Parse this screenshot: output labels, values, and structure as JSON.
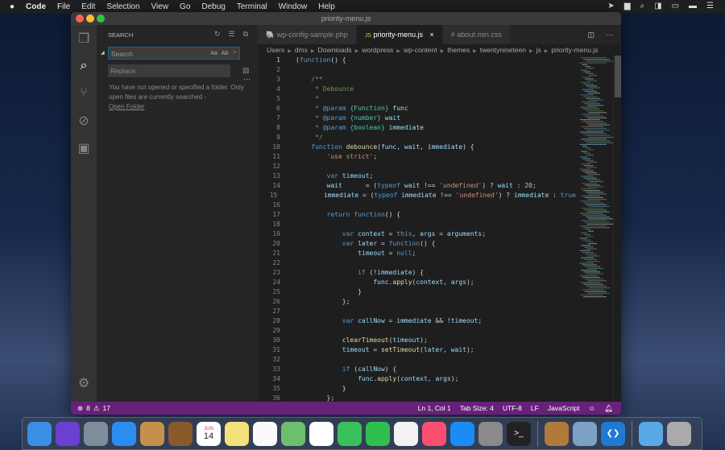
{
  "menubar": {
    "apple": "",
    "app": "Code",
    "items": [
      "File",
      "Edit",
      "Selection",
      "View",
      "Go",
      "Debug",
      "Terminal",
      "Window",
      "Help"
    ]
  },
  "window": {
    "title": "priority-menu.js"
  },
  "activity": [
    "explorer-icon",
    "search-icon",
    "source-control-icon",
    "debug-icon",
    "extensions-icon",
    "gear-icon"
  ],
  "sidebar": {
    "title": "SEARCH",
    "search_placeholder": "Search",
    "replace_placeholder": "Replace",
    "case_opt": "Aa",
    "word_opt": "Ab",
    "regex_opt": ".*",
    "message": "You have not opened or specified a folder. Only open files are currently searched -",
    "open_folder": "Open Folder"
  },
  "tabs": [
    {
      "icon": "php",
      "label": "wp-config-sample.php"
    },
    {
      "icon": "JS",
      "label": "priority-menu.js",
      "close": "×"
    },
    {
      "icon": "#",
      "label": "about.min.css"
    }
  ],
  "breadcrumbs": [
    "Users",
    "dmx",
    "Downloads",
    "wordpress",
    "wp-content",
    "themes",
    "twentynineteen",
    "js",
    "priority-menu.js"
  ],
  "code": [
    [
      [
        "(",
        "p"
      ],
      [
        "function",
        "k"
      ],
      [
        "() {",
        "p"
      ]
    ],
    [],
    [
      [
        "    /**",
        "c"
      ]
    ],
    [
      [
        "     * Debounce",
        "c"
      ]
    ],
    [
      [
        "     *",
        "c"
      ]
    ],
    [
      [
        "     * ",
        "c"
      ],
      [
        "@param",
        "k"
      ],
      [
        " {Function}",
        "t"
      ],
      [
        " func",
        "v"
      ]
    ],
    [
      [
        "     * ",
        "c"
      ],
      [
        "@param",
        "k"
      ],
      [
        " {number}",
        "t"
      ],
      [
        " wait",
        "v"
      ]
    ],
    [
      [
        "     * ",
        "c"
      ],
      [
        "@param",
        "k"
      ],
      [
        " {boolean}",
        "t"
      ],
      [
        " immediate",
        "v"
      ]
    ],
    [
      [
        "     */",
        "c"
      ]
    ],
    [
      [
        "    ",
        "p"
      ],
      [
        "function",
        "k"
      ],
      [
        " ",
        "p"
      ],
      [
        "debounce",
        "f"
      ],
      [
        "(",
        "p"
      ],
      [
        "func",
        "v"
      ],
      [
        ", ",
        "p"
      ],
      [
        "wait",
        "v"
      ],
      [
        ", ",
        "p"
      ],
      [
        "immediate",
        "v"
      ],
      [
        ") {",
        "p"
      ]
    ],
    [
      [
        "        ",
        "p"
      ],
      [
        "'use strict'",
        "s"
      ],
      [
        ";",
        "p"
      ]
    ],
    [],
    [
      [
        "        ",
        "p"
      ],
      [
        "var",
        "k"
      ],
      [
        " ",
        "p"
      ],
      [
        "timeout",
        "v"
      ],
      [
        ";",
        "p"
      ]
    ],
    [
      [
        "        ",
        "p"
      ],
      [
        "wait",
        "v"
      ],
      [
        "      = (",
        "p"
      ],
      [
        "typeof",
        "k"
      ],
      [
        " ",
        "p"
      ],
      [
        "wait",
        "v"
      ],
      [
        " !== ",
        "p"
      ],
      [
        "'undefined'",
        "s"
      ],
      [
        ") ? ",
        "p"
      ],
      [
        "wait",
        "v"
      ],
      [
        " : ",
        "p"
      ],
      [
        "20",
        "n"
      ],
      [
        ";",
        "p"
      ]
    ],
    [
      [
        "        ",
        "p"
      ],
      [
        "immediate",
        "v"
      ],
      [
        " = (",
        "p"
      ],
      [
        "typeof",
        "k"
      ],
      [
        " ",
        "p"
      ],
      [
        "immediate",
        "v"
      ],
      [
        " !== ",
        "p"
      ],
      [
        "'undefined'",
        "s"
      ],
      [
        ") ? ",
        "p"
      ],
      [
        "immediate",
        "v"
      ],
      [
        " : ",
        "p"
      ],
      [
        "true",
        "k"
      ]
    ],
    [],
    [
      [
        "        ",
        "p"
      ],
      [
        "return",
        "k"
      ],
      [
        " ",
        "p"
      ],
      [
        "function",
        "k"
      ],
      [
        "() {",
        "p"
      ]
    ],
    [],
    [
      [
        "            ",
        "p"
      ],
      [
        "var",
        "k"
      ],
      [
        " ",
        "p"
      ],
      [
        "context",
        "v"
      ],
      [
        " = ",
        "p"
      ],
      [
        "this",
        "k"
      ],
      [
        ", ",
        "p"
      ],
      [
        "args",
        "v"
      ],
      [
        " = ",
        "p"
      ],
      [
        "arguments",
        "v"
      ],
      [
        ";",
        "p"
      ]
    ],
    [
      [
        "            ",
        "p"
      ],
      [
        "var",
        "k"
      ],
      [
        " ",
        "p"
      ],
      [
        "later",
        "v"
      ],
      [
        " = ",
        "p"
      ],
      [
        "function",
        "k"
      ],
      [
        "() {",
        "p"
      ]
    ],
    [
      [
        "                ",
        "p"
      ],
      [
        "timeout",
        "v"
      ],
      [
        " = ",
        "p"
      ],
      [
        "null",
        "k"
      ],
      [
        ";",
        "p"
      ]
    ],
    [],
    [
      [
        "                ",
        "p"
      ],
      [
        "if",
        "k"
      ],
      [
        " (!",
        "p"
      ],
      [
        "immediate",
        "v"
      ],
      [
        ") {",
        "p"
      ]
    ],
    [
      [
        "                    ",
        "p"
      ],
      [
        "func",
        "v"
      ],
      [
        ".",
        "p"
      ],
      [
        "apply",
        "f"
      ],
      [
        "(",
        "p"
      ],
      [
        "context",
        "v"
      ],
      [
        ", ",
        "p"
      ],
      [
        "args",
        "v"
      ],
      [
        ");",
        "p"
      ]
    ],
    [
      [
        "                }",
        "p"
      ]
    ],
    [
      [
        "            };",
        "p"
      ]
    ],
    [],
    [
      [
        "            ",
        "p"
      ],
      [
        "var",
        "k"
      ],
      [
        " ",
        "p"
      ],
      [
        "callNow",
        "v"
      ],
      [
        " = ",
        "p"
      ],
      [
        "immediate",
        "v"
      ],
      [
        " && !",
        "p"
      ],
      [
        "timeout",
        "v"
      ],
      [
        ";",
        "p"
      ]
    ],
    [],
    [
      [
        "            ",
        "p"
      ],
      [
        "clearTimeout",
        "f"
      ],
      [
        "(",
        "p"
      ],
      [
        "timeout",
        "v"
      ],
      [
        ");",
        "p"
      ]
    ],
    [
      [
        "            ",
        "p"
      ],
      [
        "timeout",
        "v"
      ],
      [
        " = ",
        "p"
      ],
      [
        "setTimeout",
        "f"
      ],
      [
        "(",
        "p"
      ],
      [
        "later",
        "v"
      ],
      [
        ", ",
        "p"
      ],
      [
        "wait",
        "v"
      ],
      [
        ");",
        "p"
      ]
    ],
    [],
    [
      [
        "            ",
        "p"
      ],
      [
        "if",
        "k"
      ],
      [
        " (",
        "p"
      ],
      [
        "callNow",
        "v"
      ],
      [
        ") {",
        "p"
      ]
    ],
    [
      [
        "                ",
        "p"
      ],
      [
        "func",
        "v"
      ],
      [
        ".",
        "p"
      ],
      [
        "apply",
        "f"
      ],
      [
        "(",
        "p"
      ],
      [
        "context",
        "v"
      ],
      [
        ", ",
        "p"
      ],
      [
        "args",
        "v"
      ],
      [
        ");",
        "p"
      ]
    ],
    [
      [
        "            }",
        "p"
      ]
    ],
    [
      [
        "        };",
        "p"
      ]
    ]
  ],
  "statusbar": {
    "errors": "8",
    "warnings": "17",
    "position": "Ln 1, Col 1",
    "tab_size": "Tab Size: 4",
    "encoding": "UTF-8",
    "eol": "LF",
    "language": "JavaScript",
    "color": "#68217a"
  },
  "dock": [
    "finder",
    "siri",
    "launchpad",
    "safari",
    "photo-preview",
    "notes-book",
    "calendar",
    "notes",
    "reminders",
    "maps",
    "photos",
    "messages",
    "facetime",
    "news",
    "music",
    "app-store",
    "system-preferences",
    "terminal",
    "archive",
    "preview",
    "vscode",
    "downloads-folder",
    "trash"
  ],
  "calendar": {
    "month": "JUN",
    "day": "14"
  }
}
